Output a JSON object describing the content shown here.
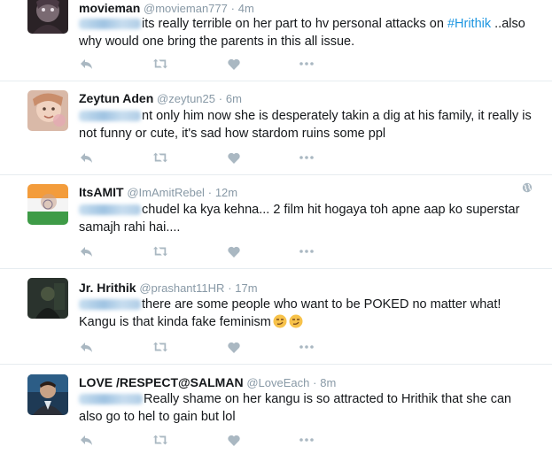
{
  "tweets": [
    {
      "name": "movieman",
      "handle": "@movieman777",
      "time": "4m",
      "text_before": "its really terrible on her part to  hv personal attacks on ",
      "hashtag": "#Hrithik",
      "text_after": " ..also why would one bring the parents in this all issue."
    },
    {
      "name": "Zeytun Aden",
      "handle": "@zeytun25",
      "time": "6m",
      "text": "nt only him now she is desperately takin a dig at his family, it really is not funny or cute, it's sad how stardom ruins some ppl"
    },
    {
      "name": "ItsAMIT",
      "handle": "@ImAmitRebel",
      "time": "12m",
      "text": "chudel ka kya kehna... 2 film hit hogaya toh apne aap ko superstar samajh rahi hai...."
    },
    {
      "name": "Jr. Hrithik",
      "handle": "@prashant11HR",
      "time": "17m",
      "text": "there are some people who want to be POKED no matter what! Kangu is that kinda fake feminism"
    },
    {
      "name": "LOVE /RESPECT@SALMAN",
      "handle": "@LoveEach",
      "time": "8m",
      "text": "Really shame on her kangu is so attracted to Hrithik that she can also go to hel  to gain but lol"
    }
  ],
  "separator": "·",
  "icons": {
    "reply": "reply-icon",
    "retweet": "retweet-icon",
    "like": "heart-icon",
    "more": "more-dots-icon",
    "globe": "globe-icon",
    "emoji": "smirk-emoji-icon"
  },
  "colors": {
    "name": "#14171a",
    "meta": "#8899a6",
    "hashtag": "#1b95e0",
    "action_icon": "#aab8c2",
    "divider": "#e6ecf0"
  }
}
